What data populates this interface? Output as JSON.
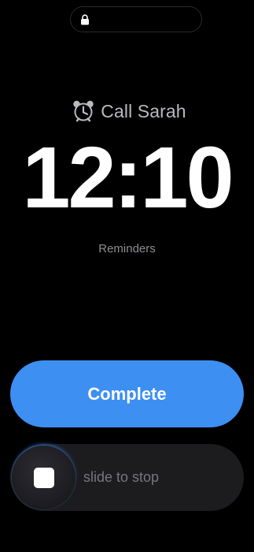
{
  "status_pill": {
    "icon": "lock-icon"
  },
  "alarm": {
    "icon": "alarm-clock-icon",
    "title": "Call Sarah",
    "time": "12:10",
    "app": "Reminders"
  },
  "actions": {
    "complete_label": "Complete",
    "slide_label": "slide to stop",
    "stop_icon": "stop-square-icon"
  },
  "colors": {
    "background": "#000000",
    "complete_button": "#3d8ff2",
    "slider_track": "#1c1c1f",
    "secondary_text": "#8e8e93"
  }
}
